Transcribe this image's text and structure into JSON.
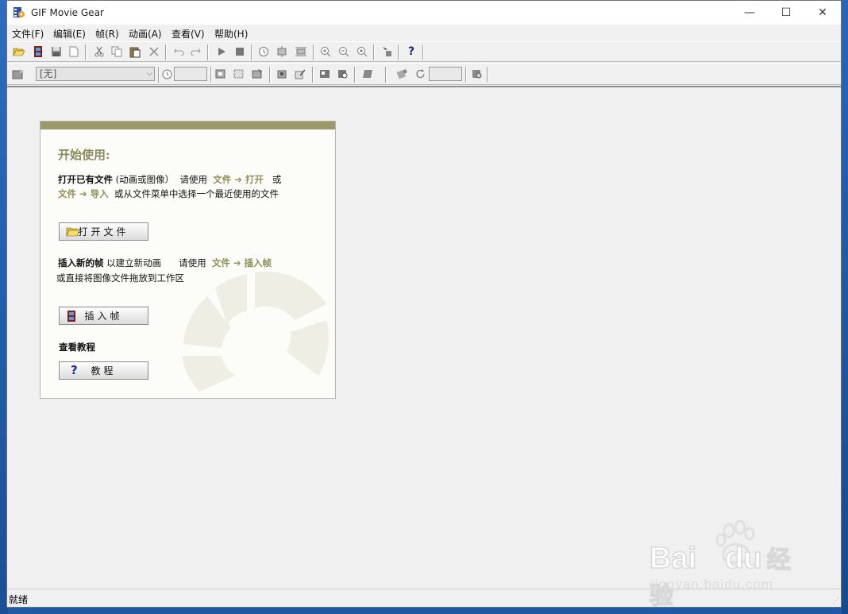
{
  "window": {
    "title": "GIF Movie Gear",
    "minimize": "—",
    "maximize": "☐",
    "close": "✕"
  },
  "menu": [
    "文件(F)",
    "编辑(E)",
    "帧(R)",
    "动画(A)",
    "查看(V)",
    "帮助(H)"
  ],
  "toolbar2": {
    "combo_value": "[无]"
  },
  "panel": {
    "title": "开始使用:",
    "open_bold": "打开已有文件",
    "open_paren": "(动画或图像）",
    "open_use": "请使用",
    "open_link1": "文件 ➔ 打开",
    "open_or": "或",
    "open_link2": "文件 ➔ 导入",
    "open_rest": "或从文件菜单中选择一个最近使用的文件",
    "open_button": "打开文件",
    "insert_bold": "插入新的帧",
    "insert_text": "以建立新动画",
    "insert_use": "请使用",
    "insert_link": "文件 ➔ 插入帧",
    "insert_rest": "或直接将图像文件拖放到工作区",
    "insert_button": "插入帧",
    "tutorial_heading": "查看教程",
    "tutorial_button": "教程"
  },
  "status": {
    "text": "就绪"
  },
  "watermark": {
    "brand": "Bai",
    "brand2": "du",
    "cn": "经验",
    "url": "jingyan.baidu.com"
  },
  "colors": {
    "accent": "#9a9a6b",
    "link": "#8f8f5a"
  }
}
